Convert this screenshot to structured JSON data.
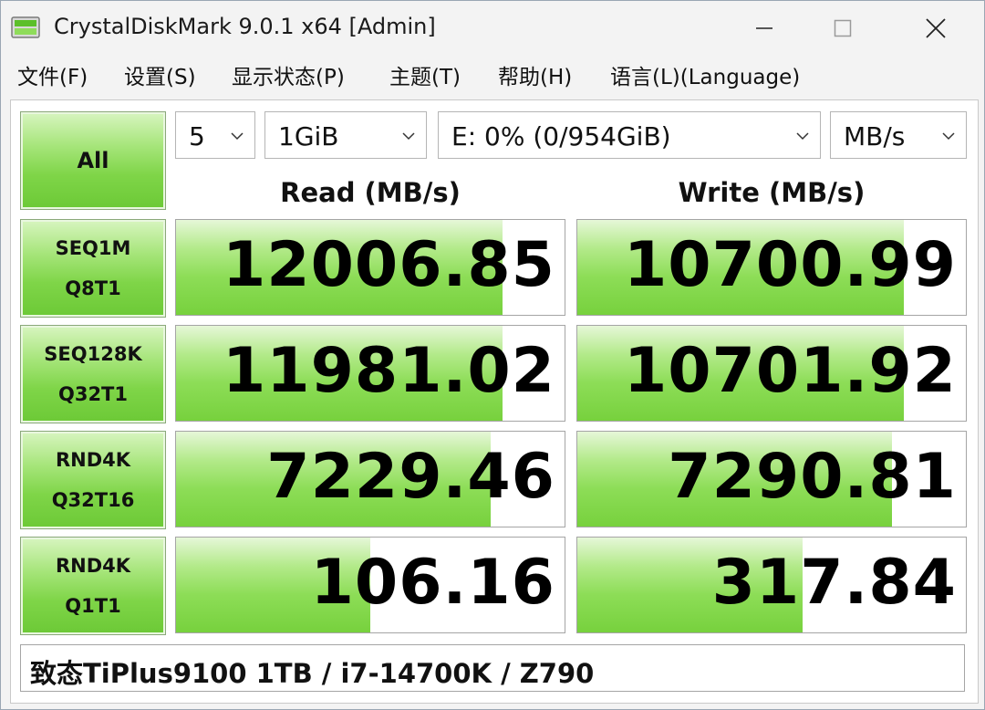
{
  "window": {
    "title": "CrystalDiskMark 9.0.1 x64 [Admin]",
    "app_icon": "crystaldiskmark-icon",
    "controls": [
      "minimize-icon",
      "maximize-icon",
      "close-icon"
    ]
  },
  "menu": {
    "items": [
      "文件(F)",
      "设置(S)",
      "显示状态(P)",
      "主题(T)",
      "帮助(H)",
      "语言(L)(Language)"
    ]
  },
  "toolbar": {
    "all_label": "All",
    "count": "5",
    "size": "1GiB",
    "drive": "E: 0% (0/954GiB)",
    "unit": "MB/s"
  },
  "columns": {
    "read": "Read (MB/s)",
    "write": "Write (MB/s)"
  },
  "tests": [
    {
      "line1": "SEQ1M",
      "line2": "Q8T1",
      "read": "12006.85",
      "write": "10700.99",
      "read_fill": 0.84,
      "write_fill": 0.84
    },
    {
      "line1": "SEQ128K",
      "line2": "Q32T1",
      "read": "11981.02",
      "write": "10701.92",
      "read_fill": 0.84,
      "write_fill": 0.84
    },
    {
      "line1": "RND4K",
      "line2": "Q32T16",
      "read": "7229.46",
      "write": "7290.81",
      "read_fill": 0.81,
      "write_fill": 0.81
    },
    {
      "line1": "RND4K",
      "line2": "Q1T1",
      "read": "106.16",
      "write": "317.84",
      "read_fill": 0.5,
      "write_fill": 0.58
    }
  ],
  "comment": "致态TiPlus9100 1TB / i7-14700K / Z790",
  "colors": {
    "accent_green": "#77d13d",
    "background": "#f3f3f3"
  }
}
